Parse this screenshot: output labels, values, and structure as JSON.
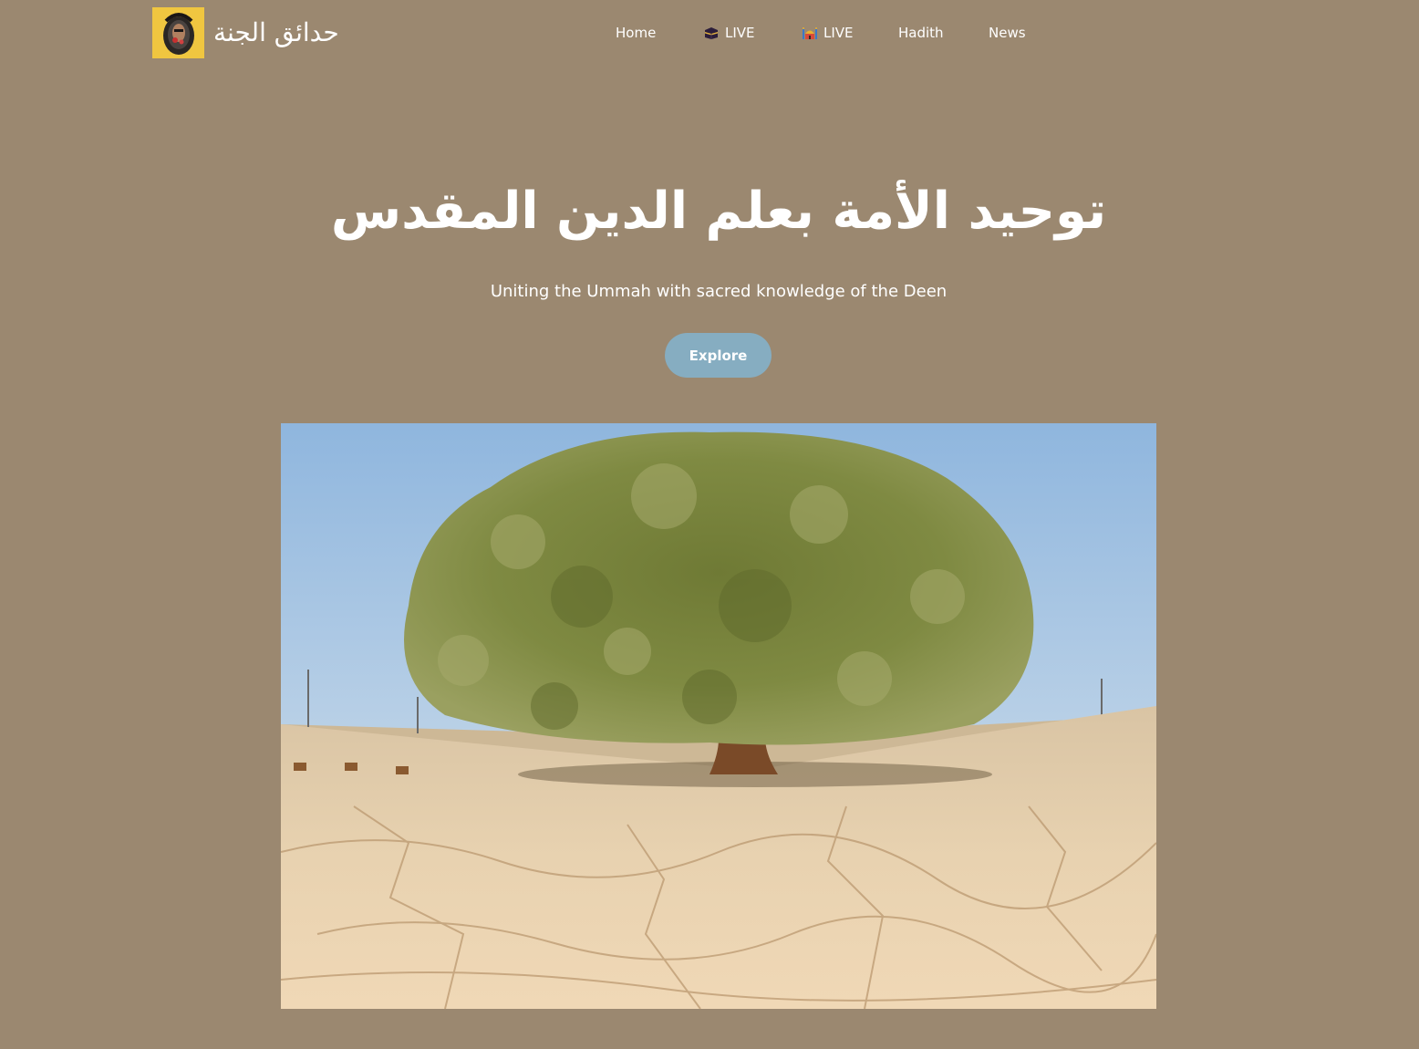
{
  "header": {
    "brand_name": "حدائق الجنة",
    "logo_icon": "hooded-figure-icon",
    "nav": [
      {
        "label": "Home",
        "icon": ""
      },
      {
        "label": "LIVE",
        "icon": "kaaba-icon"
      },
      {
        "label": "LIVE",
        "icon": "mosque-icon"
      },
      {
        "label": "Hadith",
        "icon": ""
      },
      {
        "label": "News",
        "icon": ""
      }
    ]
  },
  "hero": {
    "title": "توحيد الأمة بعلم الدين المقدس",
    "subtitle": "Uniting the Ummah with sacred knowledge of the Deen",
    "button_label": "Explore",
    "image_subject": "tree-in-desert"
  },
  "colors": {
    "background": "#9b8870",
    "button": "#86adc1",
    "logo_bg": "#f0c640",
    "text": "#ffffff"
  }
}
